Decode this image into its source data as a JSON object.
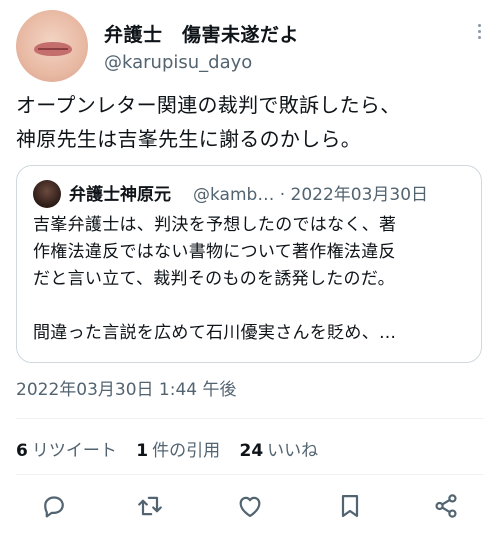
{
  "tweet": {
    "display_name": "弁護士　傷害未遂だよ",
    "handle": "@karupisu_dayo",
    "text_line1": "オープンレター関連の裁判で敗訴したら、",
    "text_line2": "神原先生は吉峯先生に謝るのかしら。",
    "timestamp": "2022年03月30日 1:44 午後"
  },
  "quote": {
    "name": "弁護士神原元",
    "handle_date": "@kamb…  · 2022年03月30日",
    "line1": "吉峯弁護士は、判決を予想したのではなく、著",
    "line2": "作権法違反ではない書物について著作権法違反",
    "line3": "だと言い立て、裁判そのものを誘発したのだ。",
    "line4": "間違った言説を広めて石川優実さんを貶め、…"
  },
  "stats": {
    "retweets_count": "6",
    "retweets_label": "リツイート",
    "quotes_count": "1",
    "quotes_label": "件の引用",
    "likes_count": "24",
    "likes_label": "いいね"
  },
  "icons": {
    "reply": "reply-icon",
    "retweet": "retweet-icon",
    "like": "heart-icon",
    "bookmark": "bookmark-icon",
    "share": "share-icon",
    "more": "more-icon"
  },
  "colors": {
    "text": "#0f1419",
    "secondary": "#536471",
    "border": "#cfd9de"
  }
}
